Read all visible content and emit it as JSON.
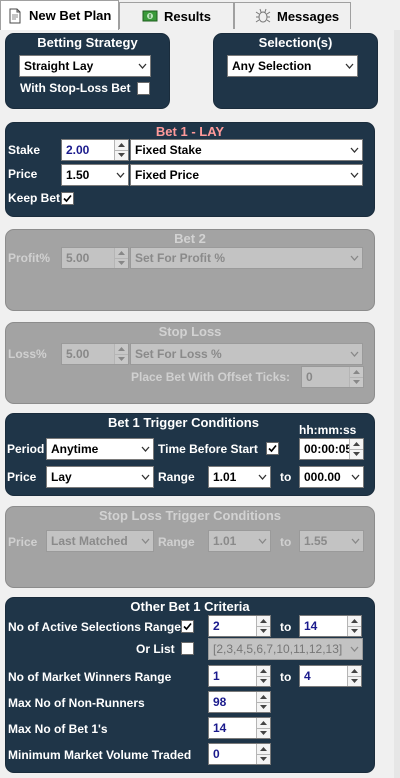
{
  "tabs": [
    {
      "label": "New Bet Plan",
      "icon": "document-icon",
      "active": true
    },
    {
      "label": "Results",
      "icon": "money-icon",
      "active": false
    },
    {
      "label": "Messages",
      "icon": "bug-icon",
      "active": false
    }
  ],
  "betting_strategy": {
    "title": "Betting Strategy",
    "strategy": "Straight Lay",
    "stop_loss_label": "With Stop-Loss Bet",
    "stop_loss_checked": false
  },
  "selections": {
    "title": "Selection(s)",
    "value": "Any Selection"
  },
  "bet1": {
    "title": "Bet 1 - LAY",
    "stake_label": "Stake",
    "stake": "2.00",
    "stake_type": "Fixed Stake",
    "price_label": "Price",
    "price": "1.50",
    "price_type": "Fixed Price",
    "keep_bet_label": "Keep Bet",
    "keep_bet_checked": true
  },
  "bet2": {
    "title": "Bet 2",
    "profit_label": "Profit%",
    "profit": "5.00",
    "profit_type": "Set For Profit %"
  },
  "stop_loss": {
    "title": "Stop Loss",
    "loss_label": "Loss%",
    "loss": "5.00",
    "loss_type": "Set For Loss %",
    "offset_label": "Place Bet With Offset Ticks:",
    "offset": "0"
  },
  "trigger": {
    "title": "Bet 1 Trigger Conditions",
    "time_format": "hh:mm:ss",
    "period_label": "Period",
    "period": "Anytime",
    "time_before_label": "Time Before Start",
    "time_before_checked": true,
    "time_value": "00:00:05",
    "price_label": "Price",
    "price": "Lay",
    "range_label": "Range",
    "range_from": "1.01",
    "to_label": "to",
    "range_to": "000.00"
  },
  "sl_trigger": {
    "title": "Stop Loss Trigger Conditions",
    "price_label": "Price",
    "price": "Last Matched",
    "range_label": "Range",
    "range_from": "1.01",
    "to_label": "to",
    "range_to": "1.55"
  },
  "criteria": {
    "title": "Other Bet 1 Criteria",
    "active_label": "No of Active Selections Range",
    "active_checked": true,
    "active_from": "2",
    "to_label": "to",
    "active_to": "14",
    "or_list_label": "Or List",
    "or_list_checked": false,
    "list_value": "[2,3,4,5,6,7,10,11,12,13]",
    "winners_label": "No of Market Winners Range",
    "winners_from": "1",
    "winners_to": "4",
    "nonrunners_label": "Max No of Non-Runners",
    "nonrunners": "98",
    "bet1s_label": "Max No of Bet 1's",
    "bet1s": "14",
    "volume_label": "Minimum Market Volume Traded",
    "volume": "0"
  },
  "colors": {
    "panel": "#1f3548",
    "panel_disabled": "#a3a3a3",
    "value_text": "#1a1a8c"
  }
}
